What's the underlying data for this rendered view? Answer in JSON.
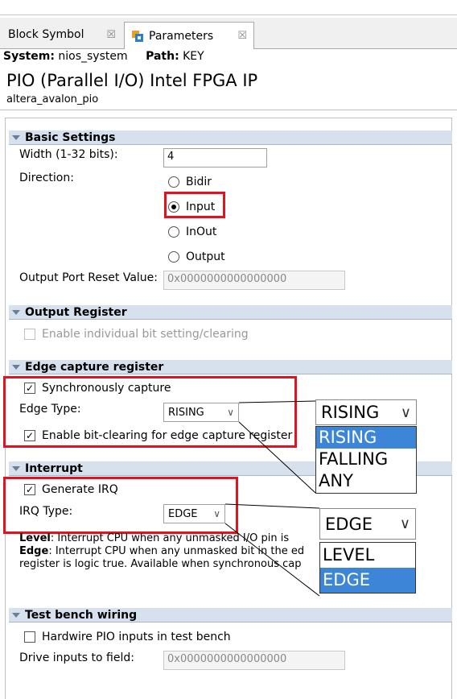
{
  "tabs": [
    {
      "label": "Block Symbol",
      "close": "☒"
    },
    {
      "label": "Parameters",
      "close": "☒"
    }
  ],
  "system_label": "System:",
  "system_value": "nios_system",
  "path_label": "Path:",
  "path_value": "KEY",
  "ip_title": "PIO (Parallel I/O) Intel FPGA IP",
  "ip_subtitle": "altera_avalon_pio",
  "basic": {
    "title": "Basic Settings",
    "width_label": "Width (1-32 bits):",
    "width_value": "4",
    "direction_label": "Direction:",
    "options": [
      "Bidir",
      "Input",
      "InOut",
      "Output"
    ],
    "selected": "Input",
    "reset_label": "Output Port Reset Value:",
    "reset_value": "0x0000000000000000"
  },
  "output_register": {
    "title": "Output Register",
    "enable_label": "Enable individual bit setting/clearing"
  },
  "edge_capture": {
    "title": "Edge capture register",
    "sync_label": "Synchronously capture",
    "edge_type_label": "Edge Type:",
    "edge_type_value": "RISING",
    "bitclear_label": "Enable bit-clearing for edge capture register"
  },
  "interrupt": {
    "title": "Interrupt",
    "irq_label": "Generate IRQ",
    "irq_type_label": "IRQ Type:",
    "irq_type_value": "EDGE",
    "desc_level_key": "Level",
    "desc_level": ": Interrupt CPU when any unmasked I/O pin is",
    "desc_edge_key": "Edge",
    "desc_edge": ": Interrupt CPU when any unmasked bit in the ed",
    "desc_line3": "register is logic true. Available when synchronous cap"
  },
  "testbench": {
    "title": "Test bench wiring",
    "hardwire_label": "Hardwire PIO inputs in test bench",
    "drive_label": "Drive inputs to field:",
    "drive_value": "0x0000000000000000"
  },
  "zoom_edge": {
    "selected": "RISING",
    "options": [
      "RISING",
      "FALLING",
      "ANY"
    ],
    "highlighted": "RISING"
  },
  "zoom_irq": {
    "selected": "EDGE",
    "options": [
      "LEVEL",
      "EDGE"
    ],
    "highlighted": "EDGE"
  },
  "chevron": "∨",
  "check": "✓",
  "colors": {
    "section_bg": "#d7e1ee",
    "highlight_red": "#e0141e",
    "selection_blue": "#3d85d6"
  }
}
